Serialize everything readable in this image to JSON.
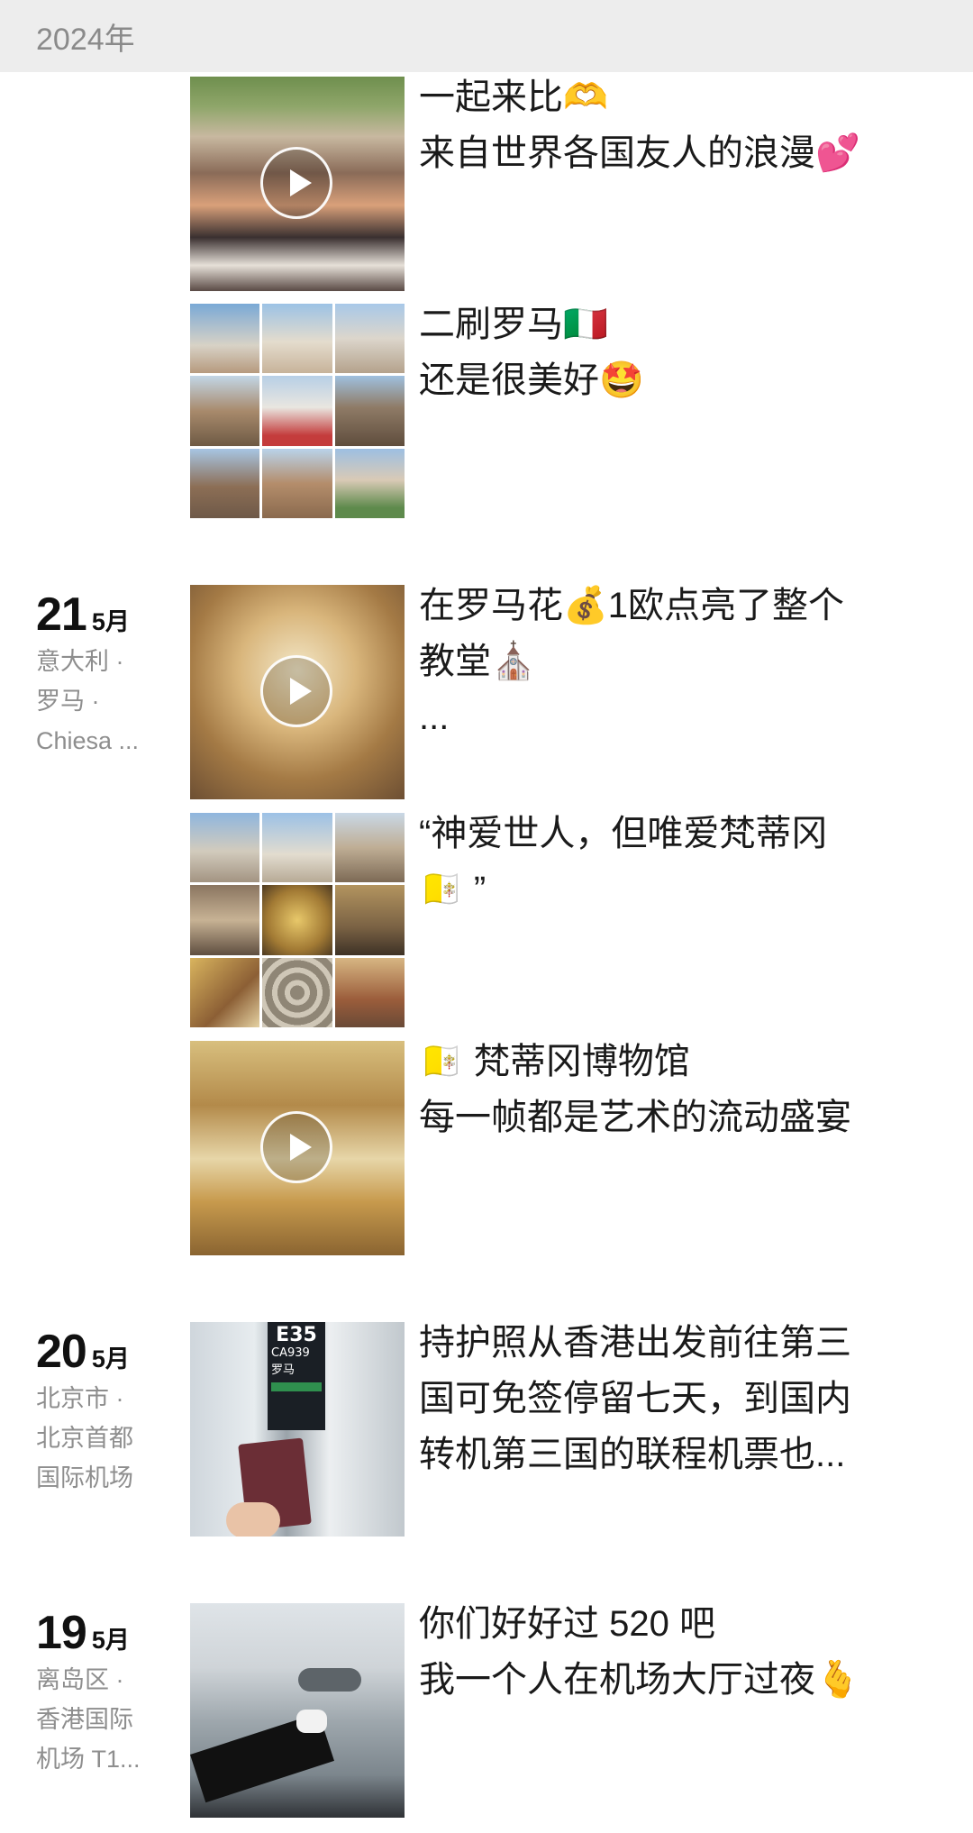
{
  "header": {
    "year": "2024年"
  },
  "days": [
    {
      "day": "21",
      "month": "5月",
      "loc": [
        "意大利 ·",
        "罗马 ·",
        "Chiesa ..."
      ]
    },
    {
      "day": "20",
      "month": "5月",
      "loc": [
        "北京市 ·",
        "北京首都",
        "国际机场"
      ]
    },
    {
      "day": "19",
      "month": "5月",
      "loc": [
        "离岛区 ·",
        "香港国际",
        "机场 T1..."
      ]
    }
  ],
  "posts": [
    {
      "lines": [
        "一起来比🫶",
        "来自世界各国友人的浪漫💕"
      ],
      "media": "video"
    },
    {
      "lines": [
        "二刷罗马🇮🇹",
        "还是很美好🤩"
      ],
      "media": "grid"
    },
    {
      "lines": [
        "在罗马花💰1欧点亮了整个",
        "教堂⛪",
        "..."
      ],
      "media": "video"
    },
    {
      "lines": [
        "“神爱世人，但唯爱梵蒂冈",
        "🇻🇦 ”"
      ],
      "media": "grid"
    },
    {
      "lines": [
        "🇻🇦 梵蒂冈博物馆",
        "每一帧都是艺术的流动盛宴"
      ],
      "media": "video"
    },
    {
      "lines": [
        "持护照从香港出发前往第三",
        "国可免签停留七天，到国内",
        "转机第三国的联程机票也..."
      ],
      "media": "photo",
      "gate": "E35",
      "flight": "CA939",
      "dest": "罗马"
    },
    {
      "lines": [
        "你们好好过 520 吧",
        "我一个人在机场大厅过夜🫰"
      ],
      "media": "photo"
    }
  ]
}
